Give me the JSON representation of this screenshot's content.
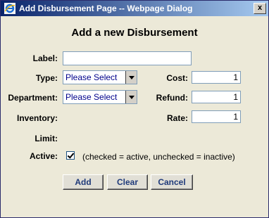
{
  "window": {
    "title": "Add Disbursement Page -- Webpage Dialog",
    "icon": "ie-icon",
    "close_label": "x"
  },
  "form": {
    "heading": "Add a new Disbursement",
    "label_label": "Label:",
    "label_value": "",
    "type_label": "Type:",
    "type_selected": "Please Select",
    "department_label": "Department:",
    "department_selected": "Please Select",
    "inventory_label": "Inventory:",
    "limit_label": "Limit:",
    "cost_label": "Cost:",
    "cost_value": "1",
    "refund_label": "Refund:",
    "refund_value": "1",
    "rate_label": "Rate:",
    "rate_value": "1",
    "active_label": "Active:",
    "active_checked": true,
    "active_note": "(checked = active, unchecked = inactive)"
  },
  "buttons": {
    "add": "Add",
    "clear": "Clear",
    "cancel": "Cancel"
  }
}
